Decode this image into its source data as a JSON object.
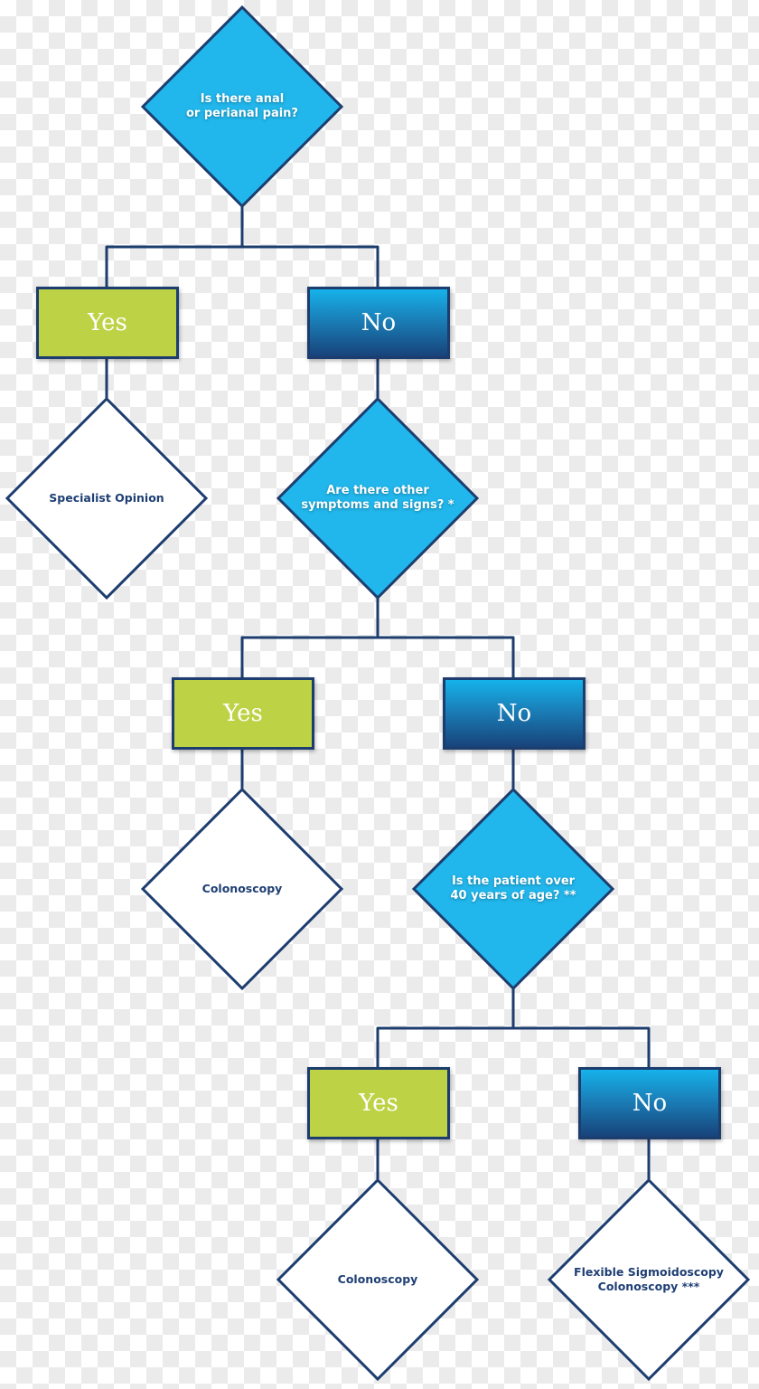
{
  "colors": {
    "question_fill": "#21b7ec",
    "outline": "#1c3d6e",
    "yes_fill": "#bdd245",
    "no_gradient_top": "#16b2ea",
    "no_gradient_bottom": "#18437a",
    "result_fill": "#ffffff",
    "result_text": "#1f3f74"
  },
  "flowchart": {
    "q1": {
      "text": "Is there anal\nor perianal pain?"
    },
    "q1_yes": {
      "label": "Yes"
    },
    "q1_no": {
      "label": "No"
    },
    "r1": {
      "text": "Specialist Opinion"
    },
    "q2": {
      "text": "Are there other\nsymptoms and signs? *"
    },
    "q2_yes": {
      "label": "Yes"
    },
    "q2_no": {
      "label": "No"
    },
    "r2": {
      "text": "Colonoscopy"
    },
    "q3": {
      "text": "Is the patient over\n40 years of age? **"
    },
    "q3_yes": {
      "label": "Yes"
    },
    "q3_no": {
      "label": "No"
    },
    "r3": {
      "text": "Colonoscopy"
    },
    "r4": {
      "text": "Flexible Sigmoidoscopy\nColonoscopy ***"
    }
  }
}
